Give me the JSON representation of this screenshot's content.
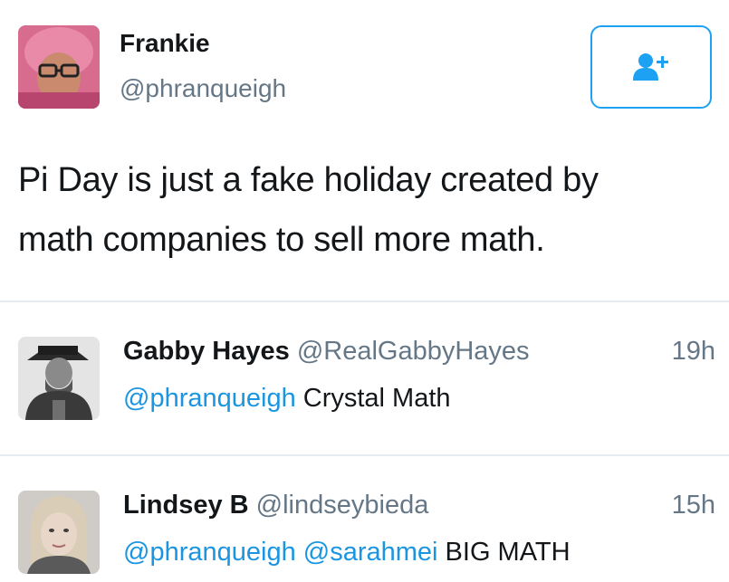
{
  "main_tweet": {
    "author_name": "Frankie",
    "author_handle": "@phranqueigh",
    "follow_icon": "add-user-icon",
    "text_line1": "Pi Day is just a fake holiday created by",
    "text_line2": "math companies to sell more math."
  },
  "replies": [
    {
      "name": "Gabby Hayes",
      "handle": "@RealGabbyHayes",
      "time": "19h",
      "mentions": [
        "@phranqueigh"
      ],
      "text": "Crystal Math"
    },
    {
      "name": "Lindsey B",
      "handle": "@lindseybieda",
      "time": "15h",
      "mentions": [
        "@phranqueigh",
        "@sarahmei"
      ],
      "text": "BIG MATH"
    }
  ],
  "colors": {
    "link": "#1b95e0",
    "follow_border": "#1da1f2",
    "secondary_text": "#657786",
    "divider": "#e6ecf0"
  }
}
